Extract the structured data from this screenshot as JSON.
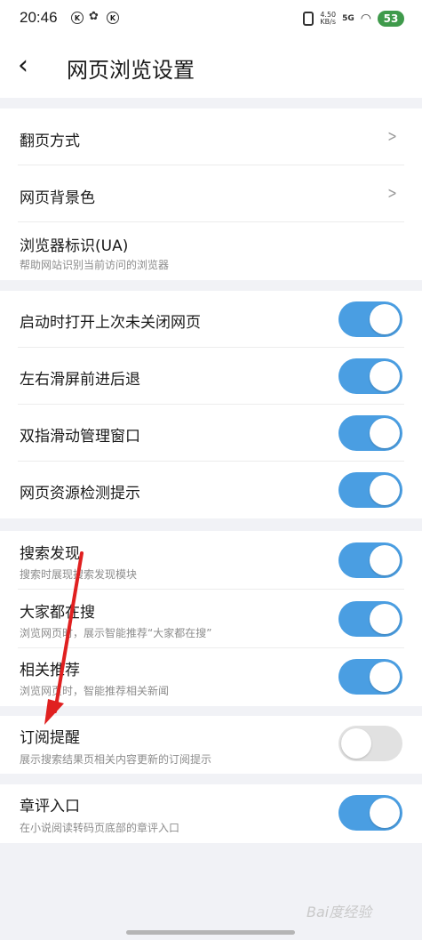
{
  "status_bar": {
    "time": "20:46",
    "notif_icon_1": "K",
    "notif_icon_2": "K",
    "net_speed_top": "4.50",
    "net_speed_bottom": "KB/s",
    "signal": "5G",
    "battery": "53"
  },
  "header": {
    "back_icon": "‹",
    "title": "网页浏览设置"
  },
  "nav_items": [
    {
      "label": "翻页方式",
      "icon": "chevron-right-icon"
    },
    {
      "label": "网页背景色",
      "icon": "chevron-right-icon"
    },
    {
      "label": "浏览器标识(UA)",
      "sub": "帮助网站识别当前访问的浏览器"
    }
  ],
  "toggles_group1": [
    {
      "label": "启动时打开上次未关闭网页",
      "on": true
    },
    {
      "label": "左右滑屏前进后退",
      "on": true
    },
    {
      "label": "双指滑动管理窗口",
      "on": true
    },
    {
      "label": "网页资源检测提示",
      "on": true
    }
  ],
  "toggles_group2": [
    {
      "label": "搜索发现",
      "sub": "搜索时展现搜索发现模块",
      "on": true
    },
    {
      "label": "大家都在搜",
      "sub": "浏览网页时，展示智能推荐“大家都在搜”",
      "on": true
    },
    {
      "label": "相关推荐",
      "sub": "浏览网页时，智能推荐相关新闻",
      "on": true
    }
  ],
  "toggles_group3": [
    {
      "label": "订阅提醒",
      "sub": "展示搜索结果页相关内容更新的订阅提示",
      "on": false
    }
  ],
  "toggles_group4": [
    {
      "label": "章评入口",
      "sub": "在小说阅读转码页底部的章评入口",
      "on": true
    }
  ],
  "watermark": "Bai度经验",
  "colors": {
    "toggle_on": "#4a9ee2",
    "toggle_off": "#e1e1e1",
    "background": "#f1f2f6",
    "battery": "#3f9a4b",
    "arrow": "#e02020"
  }
}
